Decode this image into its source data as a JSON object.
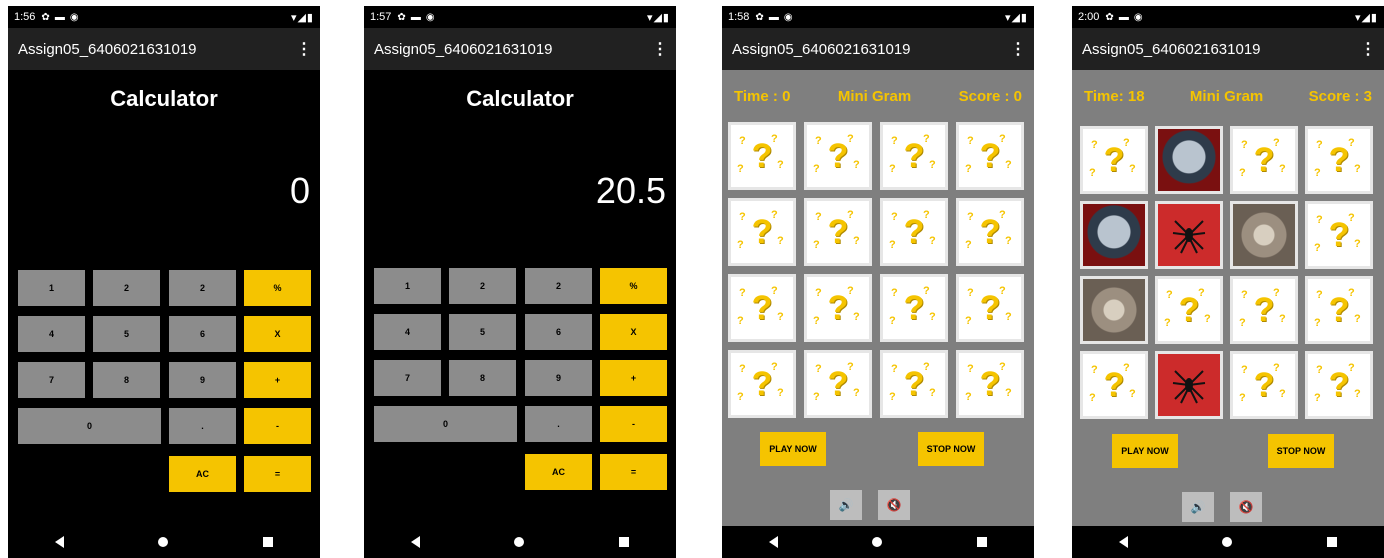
{
  "app_title": "Assign05_6406021631019",
  "menu_icon": "⋮",
  "status_icons": {
    "gear": "✿",
    "sd": "▬",
    "sync": "◉",
    "signal": "▾◢▮"
  },
  "calc_screens": [
    {
      "time": "1:56",
      "title": "Calculator",
      "display": "0"
    },
    {
      "time": "1:57",
      "title": "Calculator",
      "display": "20.5"
    }
  ],
  "calc_keys": {
    "k1": "1",
    "k2": "2",
    "k3": "2",
    "pct": "%",
    "k4": "4",
    "k5": "5",
    "k6": "6",
    "mul": "X",
    "k7": "7",
    "k8": "8",
    "k9": "9",
    "add": "+",
    "k0": "0",
    "dot": ".",
    "sub": "-",
    "ac": "AC",
    "eq": "="
  },
  "game_screens": [
    {
      "time": "1:58",
      "time_label": "Time : 0",
      "title": "Mini Gram",
      "score_label": "Score : 0"
    },
    {
      "time": "2:00",
      "time_label": "Time: 18",
      "title": "Mini Gram",
      "score_label": "Score : 3"
    }
  ],
  "game_buttons": {
    "play": "PLAY NOW",
    "stop": "STOP NOW"
  },
  "game2_cards": [
    "question",
    "kakashi",
    "question",
    "question",
    "kakashi",
    "spider",
    "cat",
    "question",
    "cat",
    "question",
    "question",
    "question",
    "question",
    "spider",
    "question",
    "question"
  ],
  "colors": {
    "accent": "#f5c400",
    "key_gray": "#8c8c8c",
    "game_bg": "#7f7f7f"
  }
}
